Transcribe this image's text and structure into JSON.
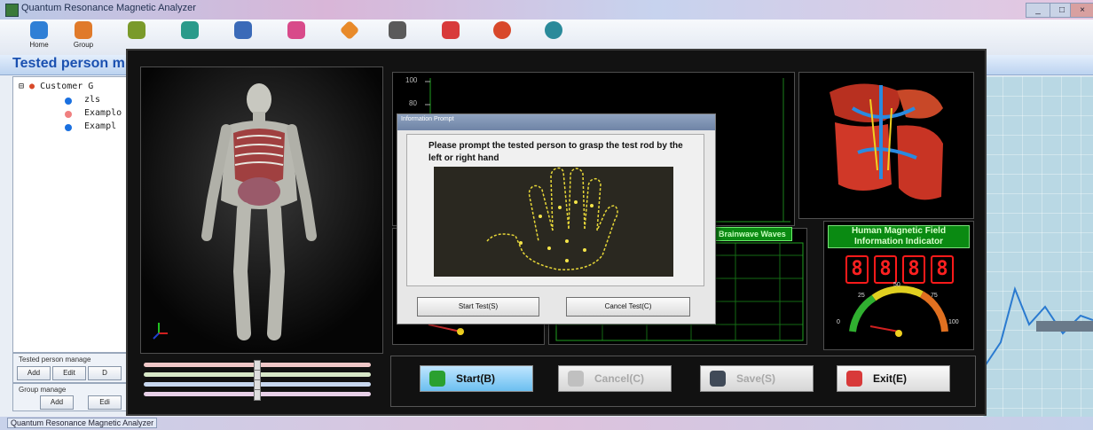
{
  "window": {
    "title": "Quantum Resonance Magnetic Analyzer"
  },
  "toolbar": {
    "items": [
      {
        "label": "Home",
        "icon": "home-icon",
        "color": "#2f7fd6"
      },
      {
        "label": "Group",
        "icon": "group-icon",
        "color": "#e07a2a"
      },
      {
        "label": "",
        "icon": "arrow-icon",
        "color": "#7a9a2a"
      },
      {
        "label": "",
        "icon": "shield-icon",
        "color": "#2a9a8a"
      },
      {
        "label": "",
        "icon": "chart-icon",
        "color": "#3a6ab8"
      },
      {
        "label": "",
        "icon": "puzzle-icon",
        "color": "#d84a8a"
      },
      {
        "label": "",
        "icon": "diamond-icon",
        "color": "#e88a2a"
      },
      {
        "label": "",
        "icon": "tools-icon",
        "color": "#5a5a5a"
      },
      {
        "label": "",
        "icon": "flag-icon",
        "color": "#d83a3a"
      },
      {
        "label": "",
        "icon": "target-icon",
        "color": "#d8482a"
      },
      {
        "label": "",
        "icon": "globe-icon",
        "color": "#2a8a9a"
      }
    ]
  },
  "header": {
    "title": "Tested person m"
  },
  "tree": {
    "root": "Customer G",
    "children": [
      "zls",
      "Examplo",
      "Exampl"
    ]
  },
  "tested_manage": {
    "caption": "Tested person manage",
    "buttons": [
      "Add",
      "Edit",
      "D"
    ]
  },
  "group_manage": {
    "caption": "Group manage",
    "buttons": [
      "Add",
      "Edi"
    ]
  },
  "chart": {
    "y_ticks": [
      "100",
      "80"
    ]
  },
  "wave": {
    "title": "Brainwave Waves"
  },
  "field": {
    "title": "Human Magnetic Field Information Indicator",
    "digits": [
      "8",
      "8",
      "8",
      "8"
    ],
    "gauge_ticks": [
      "0",
      "25",
      "50",
      "75",
      "100"
    ]
  },
  "dialog": {
    "title": "Information Prompt",
    "message": "Please prompt the tested person to grasp the test rod by the left or right hand",
    "start_label": "Start Test(S)",
    "cancel_label": "Cancel Test(C)"
  },
  "actions": {
    "start_label": "Start(B)",
    "cancel_label": "Cancel(C)",
    "save_label": "Save(S)",
    "exit_label": "Exit(E)"
  },
  "taskbar": {
    "label": "Quantum Resonance Magnetic Analyzer"
  }
}
